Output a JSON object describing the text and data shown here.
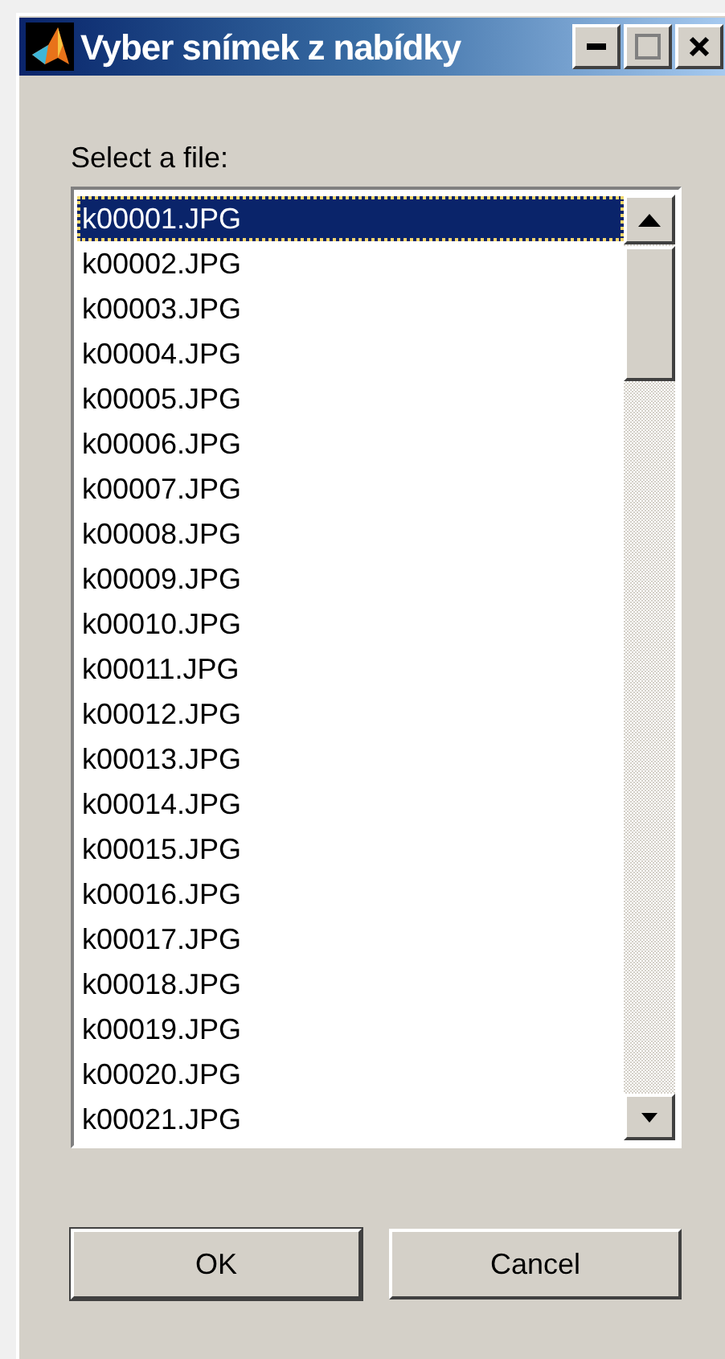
{
  "window": {
    "title": "Vyber snímek z nabídky"
  },
  "prompt": "Select a file:",
  "files": [
    {
      "name": "k00001.JPG",
      "selected": true
    },
    {
      "name": "k00002.JPG",
      "selected": false
    },
    {
      "name": "k00003.JPG",
      "selected": false
    },
    {
      "name": "k00004.JPG",
      "selected": false
    },
    {
      "name": "k00005.JPG",
      "selected": false
    },
    {
      "name": "k00006.JPG",
      "selected": false
    },
    {
      "name": "k00007.JPG",
      "selected": false
    },
    {
      "name": "k00008.JPG",
      "selected": false
    },
    {
      "name": "k00009.JPG",
      "selected": false
    },
    {
      "name": "k00010.JPG",
      "selected": false
    },
    {
      "name": "k00011.JPG",
      "selected": false
    },
    {
      "name": "k00012.JPG",
      "selected": false
    },
    {
      "name": "k00013.JPG",
      "selected": false
    },
    {
      "name": "k00014.JPG",
      "selected": false
    },
    {
      "name": "k00015.JPG",
      "selected": false
    },
    {
      "name": "k00016.JPG",
      "selected": false
    },
    {
      "name": "k00017.JPG",
      "selected": false
    },
    {
      "name": "k00018.JPG",
      "selected": false
    },
    {
      "name": "k00019.JPG",
      "selected": false
    },
    {
      "name": "k00020.JPG",
      "selected": false
    },
    {
      "name": "k00021.JPG",
      "selected": false
    }
  ],
  "buttons": [
    "OK",
    "Cancel"
  ]
}
